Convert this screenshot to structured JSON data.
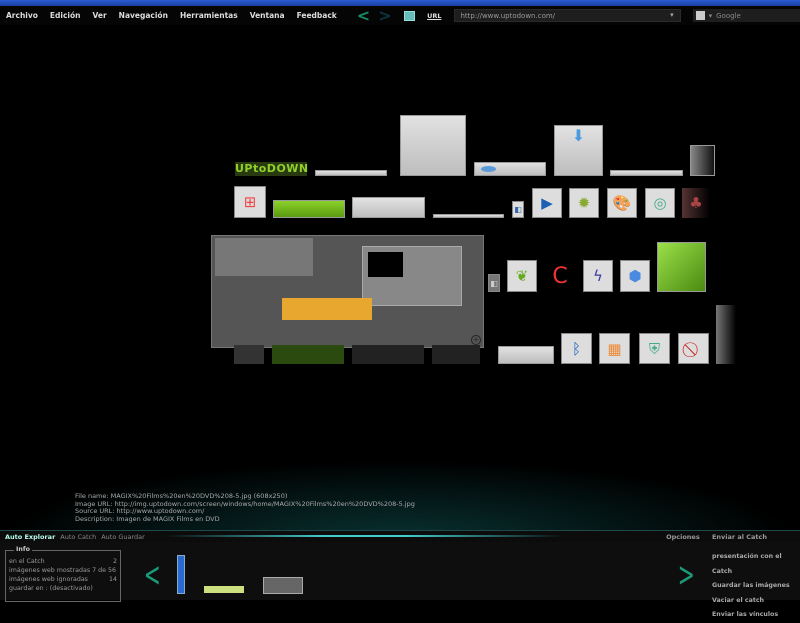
{
  "menu": [
    "Archivo",
    "Edición",
    "Ver",
    "Navegación",
    "Herramientas",
    "Ventana",
    "Feedback"
  ],
  "nav": {
    "back": "<",
    "forward": ">"
  },
  "url_label": "URL",
  "url": "http://www.uptodown.com/",
  "search_placeholder": "Google",
  "logo_text": "UPtoDOWN",
  "file_info": {
    "file_name": "File name: MAGIX%20Films%20en%20DVD%208-5.jpg (608x250)",
    "image_url": "Image URL: http://img.uptodown.com/screen/windows/home/MAGIX%20Films%20en%20DVD%208-5.jpg",
    "source_url": "Source URL: http://www.uptodown.com/",
    "description": "Description: Imagen de MAGIX Films en DVD"
  },
  "tabs": [
    "Auto Explorar",
    "Auto Catch",
    "Auto Guardar"
  ],
  "right_tabs": [
    "Opciones",
    "Enviar al Catch"
  ],
  "info": {
    "title": "Info",
    "rows": [
      {
        "label": "en el Catch",
        "value": "2"
      },
      {
        "label": "imágenes web mostradas 7 de 56",
        "value": ""
      },
      {
        "label": "imágenes web ignoradas",
        "value": "14"
      },
      {
        "label": "guardar en : (desactivado)",
        "value": ""
      }
    ]
  },
  "actions": [
    "presentación con el Catch",
    "Guardar las imágenes",
    "Vaciar el catch",
    "Enviar las vínculos"
  ]
}
